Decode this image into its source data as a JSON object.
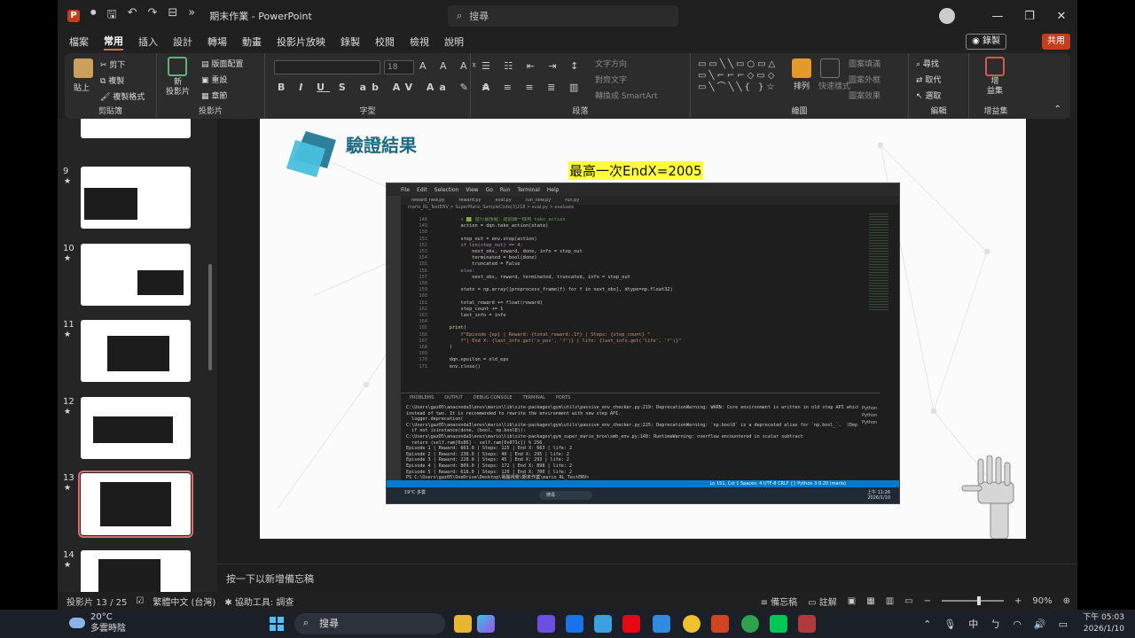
{
  "app": {
    "title": "期末作業 - PowerPoint",
    "search_placeholder": "搜尋",
    "record_label": "◉ 錄製",
    "share_label": "共用"
  },
  "menu_tabs": [
    "檔案",
    "常用",
    "插入",
    "設計",
    "轉場",
    "動畫",
    "投影片放映",
    "錄製",
    "校閱",
    "檢視",
    "說明"
  ],
  "active_tab": "常用",
  "ribbon": {
    "paste": "貼上",
    "cut": "剪下",
    "copy": "複製",
    "format_painter": "複製格式",
    "clipboard_group": "剪貼簿",
    "new_slide": "新\n投影片",
    "layout": "版面配置",
    "reset": "重設",
    "section": "章節",
    "slides_group": "投影片",
    "font_group": "字型",
    "font_size": "18",
    "text_direction": "文字方向",
    "align_text": "對齊文字",
    "smartart": "轉換成 SmartArt",
    "paragraph_group": "段落",
    "arrange": "排列",
    "quick_styles": "快速樣式",
    "shape_fill": "圖案填滿",
    "shape_outline": "圖案外框",
    "shape_effects": "圖案效果",
    "drawing_group": "繪圖",
    "find": "尋找",
    "replace": "取代",
    "select": "選取",
    "editing_group": "編輯",
    "addins": "增\n益集",
    "addins_group": "增益集"
  },
  "slides": [
    {
      "num": "9",
      "star": "★"
    },
    {
      "num": "10",
      "star": "★"
    },
    {
      "num": "11",
      "star": "★"
    },
    {
      "num": "12",
      "star": "★"
    },
    {
      "num": "13",
      "star": "★"
    },
    {
      "num": "14",
      "star": "★"
    }
  ],
  "slide": {
    "title": "驗證結果",
    "subtitle": "最高一次EndX=2005"
  },
  "vscode": {
    "menu": [
      "File",
      "Edit",
      "Selection",
      "View",
      "Go",
      "Run",
      "Terminal",
      "Help"
    ],
    "search": "mario_RL_TestENV",
    "tabs": [
      "reward_new.py",
      "reward.py",
      "eval.py",
      "run_new.py",
      "run.py"
    ],
    "breadcrumb": "mario_RL_TestENV > SuperMario_SampleCode(3)218 > eval.py > evaluate",
    "code_lines": [
      {
        "n": "148",
        "t": "        x 🟩 進行最後點：跟訓練一樣用 take_action",
        "c": "cm"
      },
      {
        "n": "149",
        "t": "        action = dqn.take_action(state)",
        "c": ""
      },
      {
        "n": "150",
        "t": "",
        "c": ""
      },
      {
        "n": "151",
        "t": "        step_out = env.step(action)",
        "c": ""
      },
      {
        "n": "152",
        "t": "        if len(step_out) == 4:",
        "c": "kw"
      },
      {
        "n": "153",
        "t": "            next_obs, reward, done, info = step_out",
        "c": ""
      },
      {
        "n": "154",
        "t": "            terminated = bool(done)",
        "c": ""
      },
      {
        "n": "155",
        "t": "            truncated = False",
        "c": ""
      },
      {
        "n": "156",
        "t": "        else:",
        "c": "kw"
      },
      {
        "n": "157",
        "t": "            next_obs, reward, terminated, truncated, info = step_out",
        "c": ""
      },
      {
        "n": "158",
        "t": "",
        "c": ""
      },
      {
        "n": "159",
        "t": "        state = np.array([preprocess_frame(f) for f in next_obs], dtype=np.float32)",
        "c": ""
      },
      {
        "n": "160",
        "t": "",
        "c": ""
      },
      {
        "n": "161",
        "t": "        total_reward += float(reward)",
        "c": ""
      },
      {
        "n": "162",
        "t": "        step_count += 1",
        "c": ""
      },
      {
        "n": "163",
        "t": "        last_info = info",
        "c": ""
      },
      {
        "n": "164",
        "t": "",
        "c": ""
      },
      {
        "n": "165",
        "t": "    print(",
        "c": "fn"
      },
      {
        "n": "166",
        "t": "        f\"Episode {ep} | Reward: {total_reward:.1f} | Steps: {step_count} \"",
        "c": "st"
      },
      {
        "n": "167",
        "t": "        f\"| End X: {last_info.get('x_pos', '?')} | life: {last_info.get('life', '?')}\"",
        "c": "st"
      },
      {
        "n": "168",
        "t": "    )",
        "c": ""
      },
      {
        "n": "169",
        "t": "",
        "c": ""
      },
      {
        "n": "170",
        "t": "    dqn.epsilon = old_eps",
        "c": ""
      },
      {
        "n": "171",
        "t": "    env.close()",
        "c": ""
      }
    ],
    "panel_tabs": [
      "PROBLEMS",
      "OUTPUT",
      "DEBUG CONSOLE",
      "TERMINAL",
      "PORTS"
    ],
    "terminal_lines": [
      "C:\\Users\\gaz05\\anaconda3\\envs\\mario\\lib\\site-packages\\gym\\utils\\passive_env_checker.py:219: DeprecationWarning: WARN: Core environment is written in old step API which returns one bool",
      "instead of two. It is recommended to rewrite the environment with new step API.",
      "  logger.deprecation(",
      "C:\\Users\\gaz05\\anaconda3\\envs\\mario\\lib\\site-packages\\gym\\utils\\passive_env_checker.py:225: DeprecationWarning: `np.bool8` is a deprecated alias for `np.bool_`.  (Deprecated NumPy 1.24)",
      "  if not isinstance(done, (bool, np.bool8)):",
      "C:\\Users\\gaz05\\anaconda3\\envs\\mario\\lib\\site-packages\\gym_super_mario_bros\\smb_env.py:148: RuntimeWarning: overflow encountered in scalar subtract",
      "  return (self.ram[0x86] - self.ram[0x071c]) % 256",
      "Episode 1 | Reward: 663.0 | Steps: 125 | End X: 663 | life: 2",
      "Episode 2 | Reward: 238.0 | Steps: 40 | End X: 295 | life: 2",
      "Episode 3 | Reward: 228.0 | Steps: 45 | End X: 293 | life: 2",
      "Episode 4 | Reward: 809.0 | Steps: 172 | End X: 898 | life: 2",
      "Episode 5 | Reward: 618.0 | Steps: 129 | End X: 700 | life: 2",
      "PS C:\\Users\\gaz05\\OneDrive\\Desktop\\電腦視覺\\期末作業\\mario_RL_TestENV>"
    ],
    "terminal_side": [
      "Python",
      "Python",
      "Python"
    ],
    "status": "Ln 151, Col 1   Spaces: 4   UTF-8   CRLF   {} Python   3.9.20 (mario)",
    "taskbar_search": "搜尋",
    "taskbar_weather": "19°C 多雲",
    "taskbar_clock": "上午 11:26 2026/1/10"
  },
  "notes_placeholder": "按一下以新增備忘稿",
  "status": {
    "slide_counter": "投影片 13 / 25",
    "language": "繁體中文 (台灣)",
    "accessibility": "協助工具: 調查",
    "notes": "備忘稿",
    "comments": "註解",
    "zoom": "90%",
    "zoom_fraction": 0.6
  },
  "taskbar": {
    "temperature": "20°C",
    "weather": "多雲時陰",
    "search": "搜尋",
    "ime": "中",
    "time": "下午 05:03",
    "date": "2026/1/10"
  },
  "colors": {
    "accent": "#c43e1c",
    "title_color": "#1a6b83",
    "highlight": "#ffff3a",
    "vscode_blue": "#007acc"
  }
}
